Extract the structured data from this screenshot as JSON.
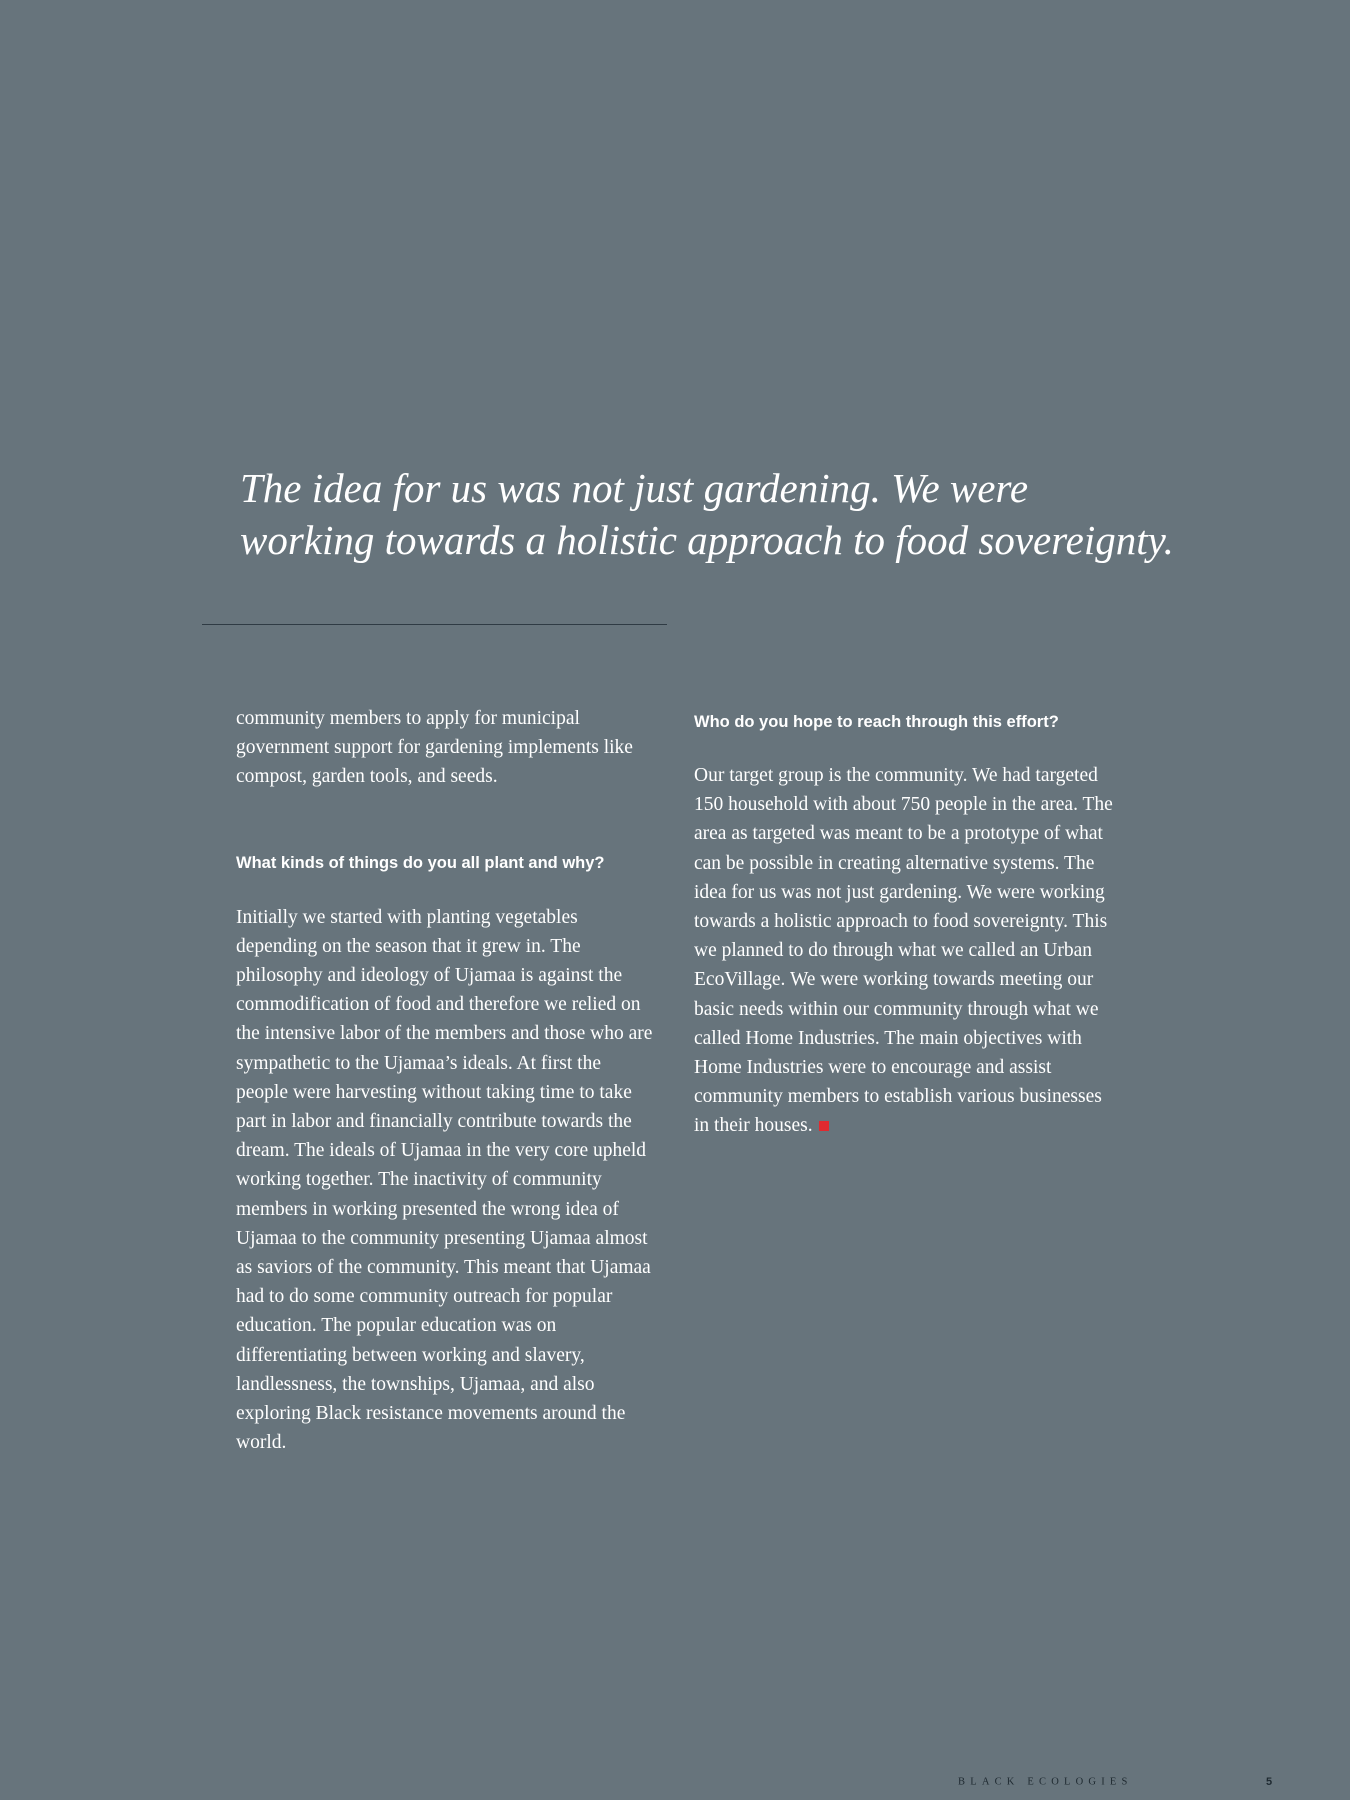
{
  "pull_quote": {
    "line1": "The idea for us was not just gardening. We were",
    "line2": "working towards a holistic approach to food sovereignty."
  },
  "left_column": {
    "continuation": "community members to apply for municipal government support for gardening implements like compost, garden tools, and seeds.",
    "question": "What kinds of things do you all plant and why?",
    "answer": "Initially we started with planting vegetables depending on the season that it grew in. The philosophy and ideology of Ujamaa is against the commodification of food and therefore we relied on the intensive labor of the members and those who are sympathetic to the Ujamaa’s ideals. At first the people were harvesting without taking time to take part in labor and financially contribute towards the dream. The ideals of Ujamaa in the very core upheld working together. The inactivity of community members in working presented the wrong idea of Ujamaa to the community presenting Ujamaa almost as saviors of the community. This meant that Ujamaa had to do some community outreach for popular education. The popular education was on differentiating between working and slavery, landlessness, the townships, Ujamaa, and also exploring Black resistance movements around the world."
  },
  "right_column": {
    "question": "Who do you hope to reach through this effort?",
    "answer": "Our target group is the community. We had targeted 150 household with about 750 people in the area. The area as targeted was meant to be a prototype of what can be possible in creating alternative systems. The idea for us was not just gardening. We were working towards a holistic approach to food sovereignty. This we planned to do through what we called an Urban EcoVillage. We were working towards meeting our basic needs within our community through what we called Home Industries. The main objectives with Home Industries were to encourage and assist community members to establish various businesses in their houses."
  },
  "footer": {
    "running_title": "BLACK ECOLOGIES",
    "page_number": "5"
  },
  "colors": {
    "background": "#67747c",
    "text": "#ffffff",
    "end_mark": "#e02a2f",
    "footer_text": "#1f2a31"
  }
}
